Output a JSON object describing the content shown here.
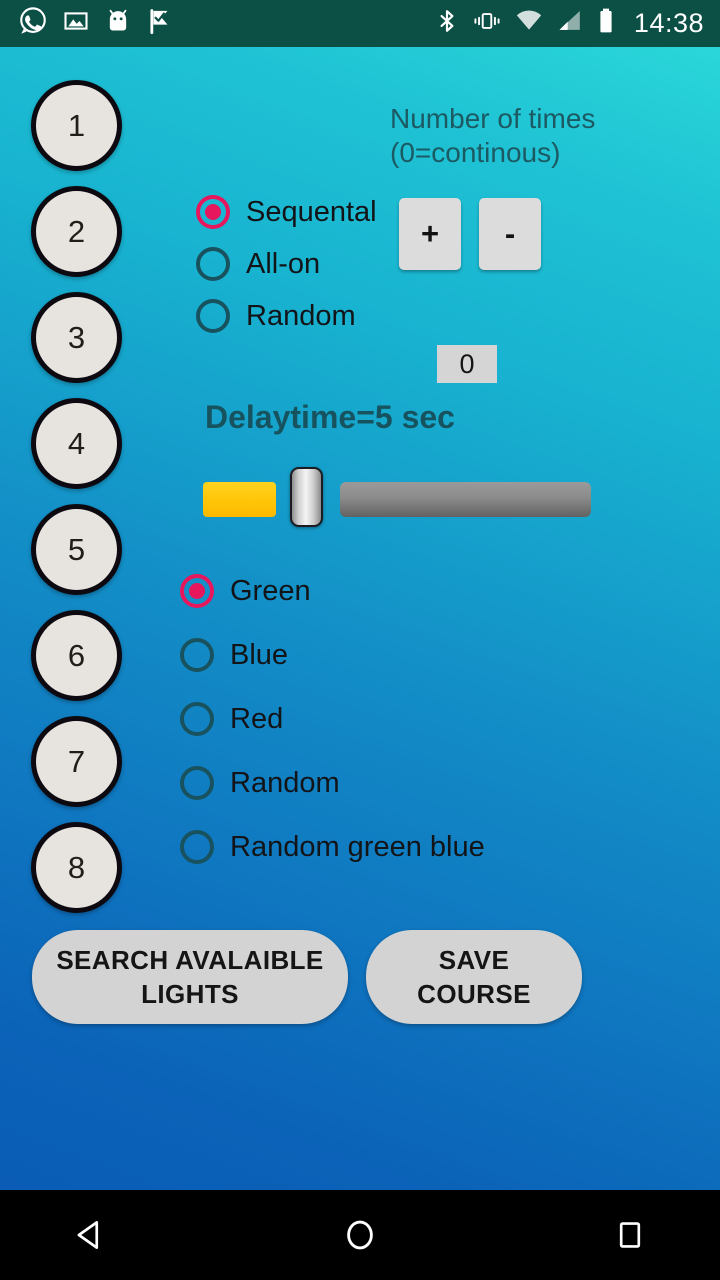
{
  "status_bar": {
    "time": "14:38",
    "left_icons": [
      "whatsapp-icon",
      "image-icon",
      "android-icon",
      "checkmark-flag-icon"
    ],
    "right_icons": [
      "bluetooth-icon",
      "vibrate-icon",
      "wifi-icon",
      "cell-signal-icon",
      "battery-icon"
    ],
    "background_color": "#0b4f45"
  },
  "light_buttons": [
    {
      "label": "1"
    },
    {
      "label": "2"
    },
    {
      "label": "3"
    },
    {
      "label": "4"
    },
    {
      "label": "5"
    },
    {
      "label": "6"
    },
    {
      "label": "7"
    },
    {
      "label": "8"
    }
  ],
  "times": {
    "label": "Number of times\n(0=continous)",
    "value": "0",
    "increment_label": "+",
    "decrement_label": "-"
  },
  "mode_group": {
    "selected_index": 0,
    "options": [
      {
        "label": "Sequental",
        "selected": true
      },
      {
        "label": "All-on",
        "selected": false
      },
      {
        "label": "Random",
        "selected": false
      }
    ]
  },
  "delay": {
    "label": "Delaytime=5 sec",
    "value": 5,
    "min": 0,
    "max": 25,
    "percent": 20
  },
  "color_group": {
    "selected_index": 0,
    "options": [
      {
        "label": "Green",
        "selected": true
      },
      {
        "label": "Blue",
        "selected": false
      },
      {
        "label": "Red",
        "selected": false
      },
      {
        "label": "Random",
        "selected": false
      },
      {
        "label": "Random green blue",
        "selected": false
      }
    ]
  },
  "actions": {
    "search_label": "SEARCH AVALAIBLE LIGHTS",
    "save_label": "SAVE COURSE"
  },
  "nav_bar": {
    "back": "back-triangle-icon",
    "home": "home-circle-icon",
    "recents": "recents-square-icon"
  },
  "colors": {
    "accent_selected": "#e6175c",
    "radio_ring": "#18525e",
    "bg_top": "#2ad7d9",
    "bg_bottom": "#0a5cb4",
    "slider_fill": "#ffc507",
    "button_face": "#d3d3d3",
    "circle_face": "#e7e3de"
  }
}
